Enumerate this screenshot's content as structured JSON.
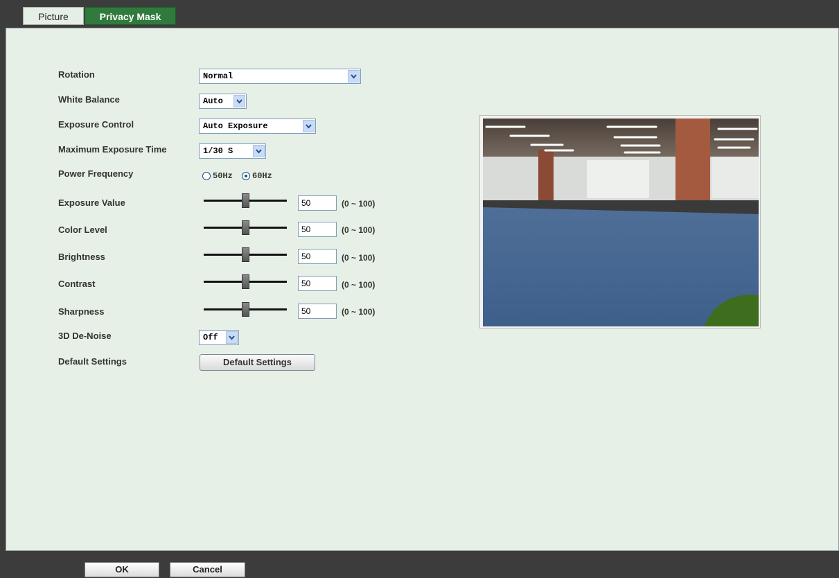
{
  "tabs": [
    {
      "label": "Picture",
      "active": false
    },
    {
      "label": "Privacy Mask",
      "active": true
    }
  ],
  "form": {
    "rotation": {
      "label": "Rotation",
      "value": "Normal"
    },
    "white_balance": {
      "label": "White Balance",
      "value": "Auto"
    },
    "exposure_control": {
      "label": "Exposure Control",
      "value": "Auto Exposure"
    },
    "max_exposure_time": {
      "label": "Maximum Exposure Time",
      "value": "1/30 S"
    },
    "power_frequency": {
      "label": "Power Frequency",
      "options": [
        "50Hz",
        "60Hz"
      ],
      "selected": "60Hz"
    },
    "exposure_value": {
      "label": "Exposure Value",
      "value": "50",
      "range": "(0 ~ 100)"
    },
    "color_level": {
      "label": "Color Level",
      "value": "50",
      "range": "(0 ~ 100)"
    },
    "brightness": {
      "label": "Brightness",
      "value": "50",
      "range": "(0 ~ 100)"
    },
    "contrast": {
      "label": "Contrast",
      "value": "50",
      "range": "(0 ~ 100)"
    },
    "sharpness": {
      "label": "Sharpness",
      "value": "50",
      "range": "(0 ~ 100)"
    },
    "de_noise": {
      "label": "3D De-Noise",
      "value": "Off"
    },
    "default_settings": {
      "label": "Default Settings",
      "button": "Default Settings"
    }
  },
  "footer": {
    "ok": "OK",
    "cancel": "Cancel"
  },
  "colors": {
    "active_tab": "#2f7a3c",
    "panel_bg": "#e6f0e6",
    "frame": "#3c3c3c"
  }
}
